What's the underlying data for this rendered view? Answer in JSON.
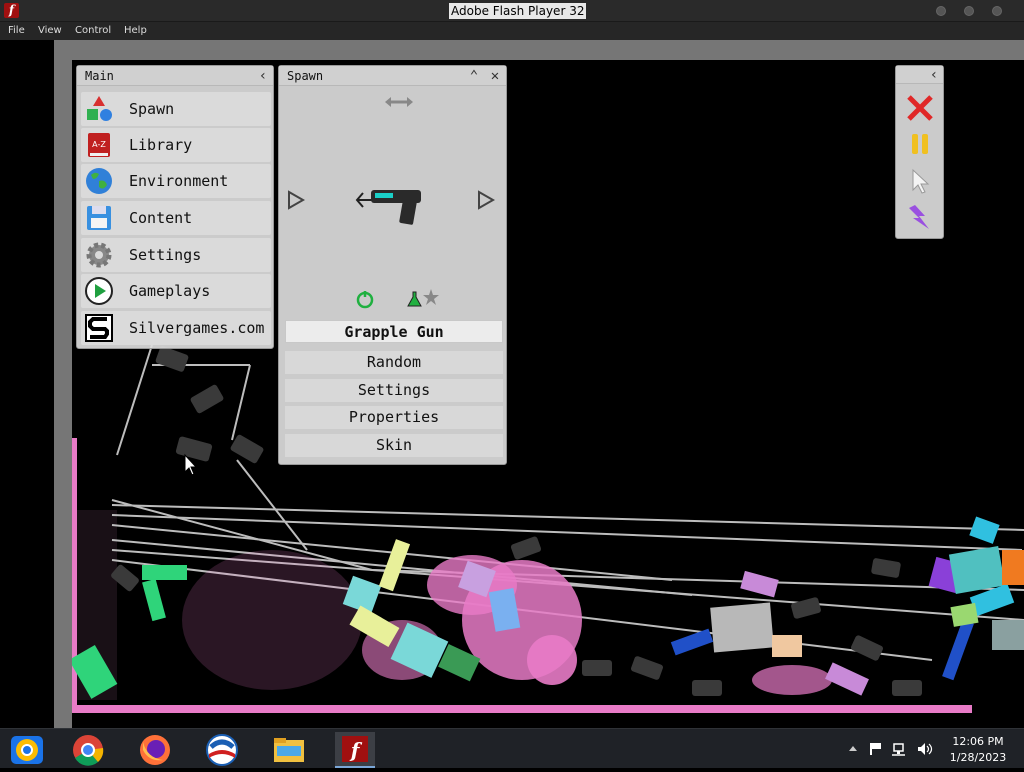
{
  "window": {
    "title": "Adobe Flash Player 32",
    "app_icon": "flash-icon"
  },
  "menubar": {
    "items": [
      {
        "label": "File"
      },
      {
        "label": "View"
      },
      {
        "label": "Control"
      },
      {
        "label": "Help"
      }
    ]
  },
  "main_panel": {
    "title": "Main",
    "items": [
      {
        "label": "Spawn",
        "icon": "spawn-shapes-icon"
      },
      {
        "label": "Library",
        "icon": "library-book-icon"
      },
      {
        "label": "Environment",
        "icon": "globe-icon"
      },
      {
        "label": "Content",
        "icon": "floppy-disk-icon"
      },
      {
        "label": "Settings",
        "icon": "gear-icon"
      },
      {
        "label": "Gameplays",
        "icon": "play-icon"
      },
      {
        "label": "Silvergames.com",
        "icon": "silvergames-logo-icon"
      }
    ]
  },
  "spawn_panel": {
    "title": "Spawn",
    "selected_item": "Grapple Gun",
    "buttons": [
      {
        "label": "Random"
      },
      {
        "label": "Settings"
      },
      {
        "label": "Properties"
      },
      {
        "label": "Skin"
      }
    ]
  },
  "toolbar": {
    "tools": [
      "close-x-icon",
      "pause-icon",
      "cursor-icon",
      "lightning-icon"
    ]
  },
  "taskbar": {
    "apps": [
      "chrome-os-icon",
      "chrome-icon",
      "firefox-icon",
      "obama-logo-icon",
      "file-explorer-icon",
      "flash-player-icon"
    ],
    "time": "12:06 PM",
    "date": "1/28/2023"
  },
  "colors": {
    "accent_pink": "#e87bc7",
    "game_bg": "#000000",
    "stage_border": "#767676"
  }
}
